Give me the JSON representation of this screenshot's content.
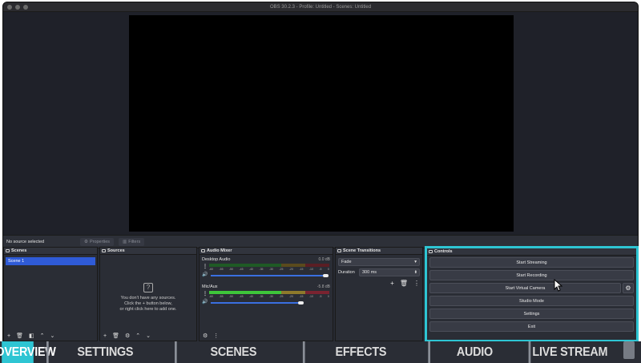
{
  "window": {
    "title": "OBS 30.2.3 - Profile: Untitled - Scenes: Untitled"
  },
  "source_bar": {
    "status": "No source selected",
    "properties": "Properties",
    "filters": "Filters"
  },
  "scenes": {
    "title": "Scenes",
    "items": [
      "Scene 1"
    ]
  },
  "sources": {
    "title": "Sources",
    "empty_line1": "You don't have any sources.",
    "empty_line2": "Click the + button below,",
    "empty_line3": "or right click here to add one."
  },
  "audio_mixer": {
    "title": "Audio Mixer",
    "tracks": [
      {
        "name": "Desktop Audio",
        "db": "0.0 dB",
        "level": 0,
        "volume": 1.0
      },
      {
        "name": "Mic/Aux",
        "db": "-5.8 dB",
        "level": 0.9,
        "volume": 0.8
      }
    ],
    "ticks": [
      "-60",
      "-55",
      "-50",
      "-45",
      "-40",
      "-35",
      "-30",
      "-25",
      "-20",
      "-15",
      "-10",
      "-5",
      "0"
    ]
  },
  "transitions": {
    "title": "Scene Transitions",
    "selected": "Fade",
    "duration_label": "Duration",
    "duration_value": "300 ms"
  },
  "controls": {
    "title": "Controls",
    "start_streaming": "Start Streaming",
    "start_recording": "Start Recording",
    "start_virtual_camera": "Start Virtual Camera",
    "studio_mode": "Studio Mode",
    "settings": "Settings",
    "exit": "Exit"
  },
  "nav": {
    "overview": "OVERVIEW",
    "settings": "SETTINGS",
    "scenes": "SCENES",
    "effects": "EFFECTS",
    "audio": "AUDIO",
    "live_stream": "LIVE STREAM"
  },
  "colors": {
    "accent": "#2ec5d3",
    "selection": "#2f5bd7",
    "meter_green": "#3ec63a"
  }
}
